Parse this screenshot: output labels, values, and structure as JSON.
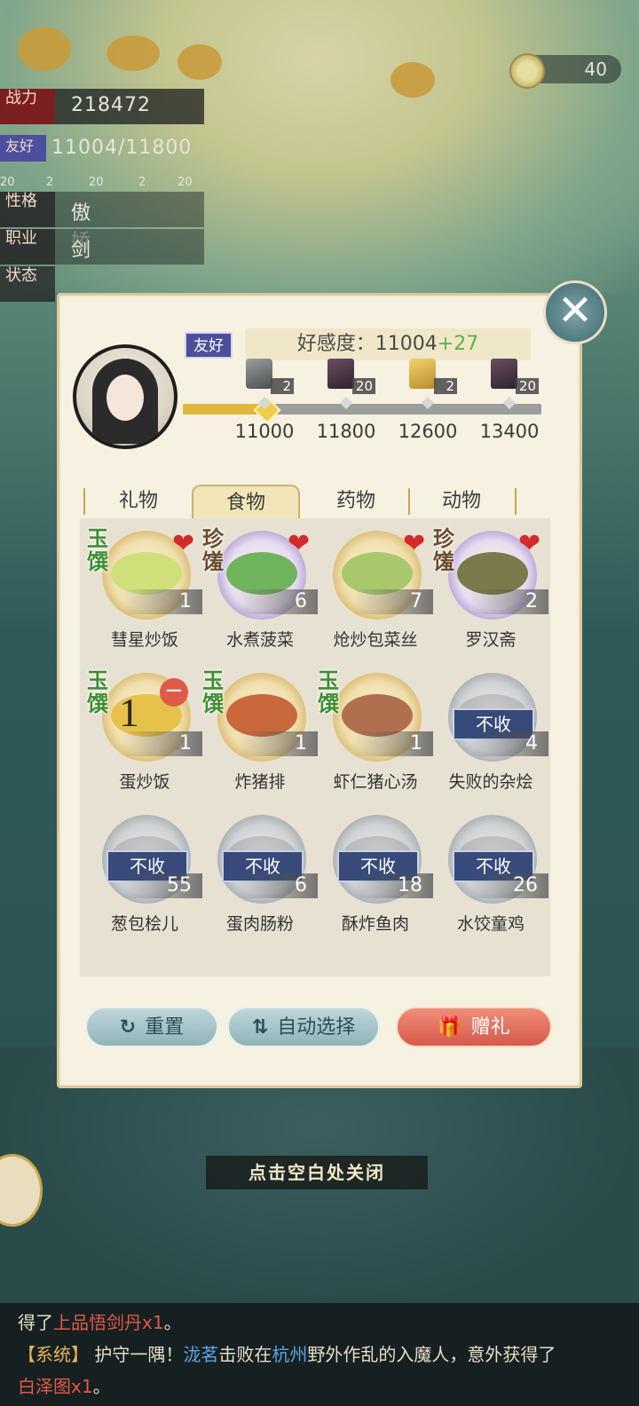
{
  "hud": {
    "power_tag": "战力",
    "power_value": "218472",
    "friend_tag": "友好",
    "friend_value": "11004/11800",
    "reward_counts": [
      "20",
      "2",
      "20",
      "2",
      "20"
    ],
    "personality_tag": "性格",
    "personality_value": "傲娇",
    "job_tag": "职业",
    "job_value": "剑",
    "status_tag": "状态",
    "bowl_count": "40"
  },
  "panel": {
    "relation_badge": "友好",
    "affection_label": "好感度：",
    "affection_value": "11004",
    "affection_delta": "+27",
    "progress_fraction": 0.23,
    "milestones": [
      {
        "value": "11000",
        "reward_icon": "stone-icon",
        "reward_count": "2"
      },
      {
        "value": "11800",
        "reward_icon": "chest-icon",
        "reward_count": "20"
      },
      {
        "value": "12600",
        "reward_icon": "gold-stone-icon",
        "reward_count": "2"
      },
      {
        "value": "13400",
        "reward_icon": "chest-icon",
        "reward_count": "20"
      }
    ],
    "tabs": [
      "礼物",
      "食物",
      "药物",
      "动物"
    ],
    "active_tab": "食物",
    "items": [
      {
        "name": "彗星炒饭",
        "count": "1",
        "grade": "玉馔",
        "liked": true,
        "rejected": false,
        "dish": "gold"
      },
      {
        "name": "水煮菠菜",
        "count": "6",
        "grade": "珍馐",
        "liked": true,
        "rejected": false,
        "dish": "purple"
      },
      {
        "name": "炝炒包菜丝",
        "count": "7",
        "grade": "",
        "liked": true,
        "rejected": false,
        "dish": "gold"
      },
      {
        "name": "罗汉斋",
        "count": "2",
        "grade": "珍馐",
        "liked": true,
        "rejected": false,
        "dish": "purple"
      },
      {
        "name": "蛋炒饭",
        "count": "1",
        "grade": "玉馔",
        "liked": false,
        "rejected": false,
        "dish": "gold",
        "selected_qty": "1"
      },
      {
        "name": "炸猪排",
        "count": "1",
        "grade": "玉馔",
        "liked": false,
        "rejected": false,
        "dish": "gold"
      },
      {
        "name": "虾仁猪心汤",
        "count": "1",
        "grade": "玉馔",
        "liked": false,
        "rejected": false,
        "dish": "gold"
      },
      {
        "name": "失败的杂烩",
        "count": "4",
        "grade": "",
        "liked": false,
        "rejected": true,
        "dish": "grey"
      },
      {
        "name": "葱包桧儿",
        "count": "55",
        "grade": "",
        "liked": false,
        "rejected": true,
        "dish": "grey"
      },
      {
        "name": "蛋肉肠粉",
        "count": "6",
        "grade": "",
        "liked": false,
        "rejected": true,
        "dish": "grey"
      },
      {
        "name": "酥炸鱼肉",
        "count": "18",
        "grade": "",
        "liked": false,
        "rejected": true,
        "dish": "grey"
      },
      {
        "name": "水饺童鸡",
        "count": "26",
        "grade": "",
        "liked": false,
        "rejected": true,
        "dish": "grey"
      }
    ],
    "reject_label": "不收",
    "buttons": {
      "reset": "重置",
      "auto": "自动选择",
      "gift": "赠礼"
    },
    "close_hint": "点击空白处关闭"
  },
  "chat": {
    "line1_prefix": "得了",
    "line1_item": "上品悟剑丹x1",
    "line1_suffix": "。",
    "line2_sys": "【系统】",
    "line2_text1": " 护守一隅！",
    "line2_name": "泷茗",
    "line2_text2": "击败在",
    "line2_place": "杭州",
    "line2_text3": "野外作乱的入魔人，意外获得了",
    "line3_item": "白泽图x1",
    "line3_suffix": "。"
  },
  "colors": {
    "accent_gold": "#e1b83d",
    "like_heart": "#d42a2a",
    "gift_button": "#d4594c",
    "reject_badge": "#374a7a"
  }
}
